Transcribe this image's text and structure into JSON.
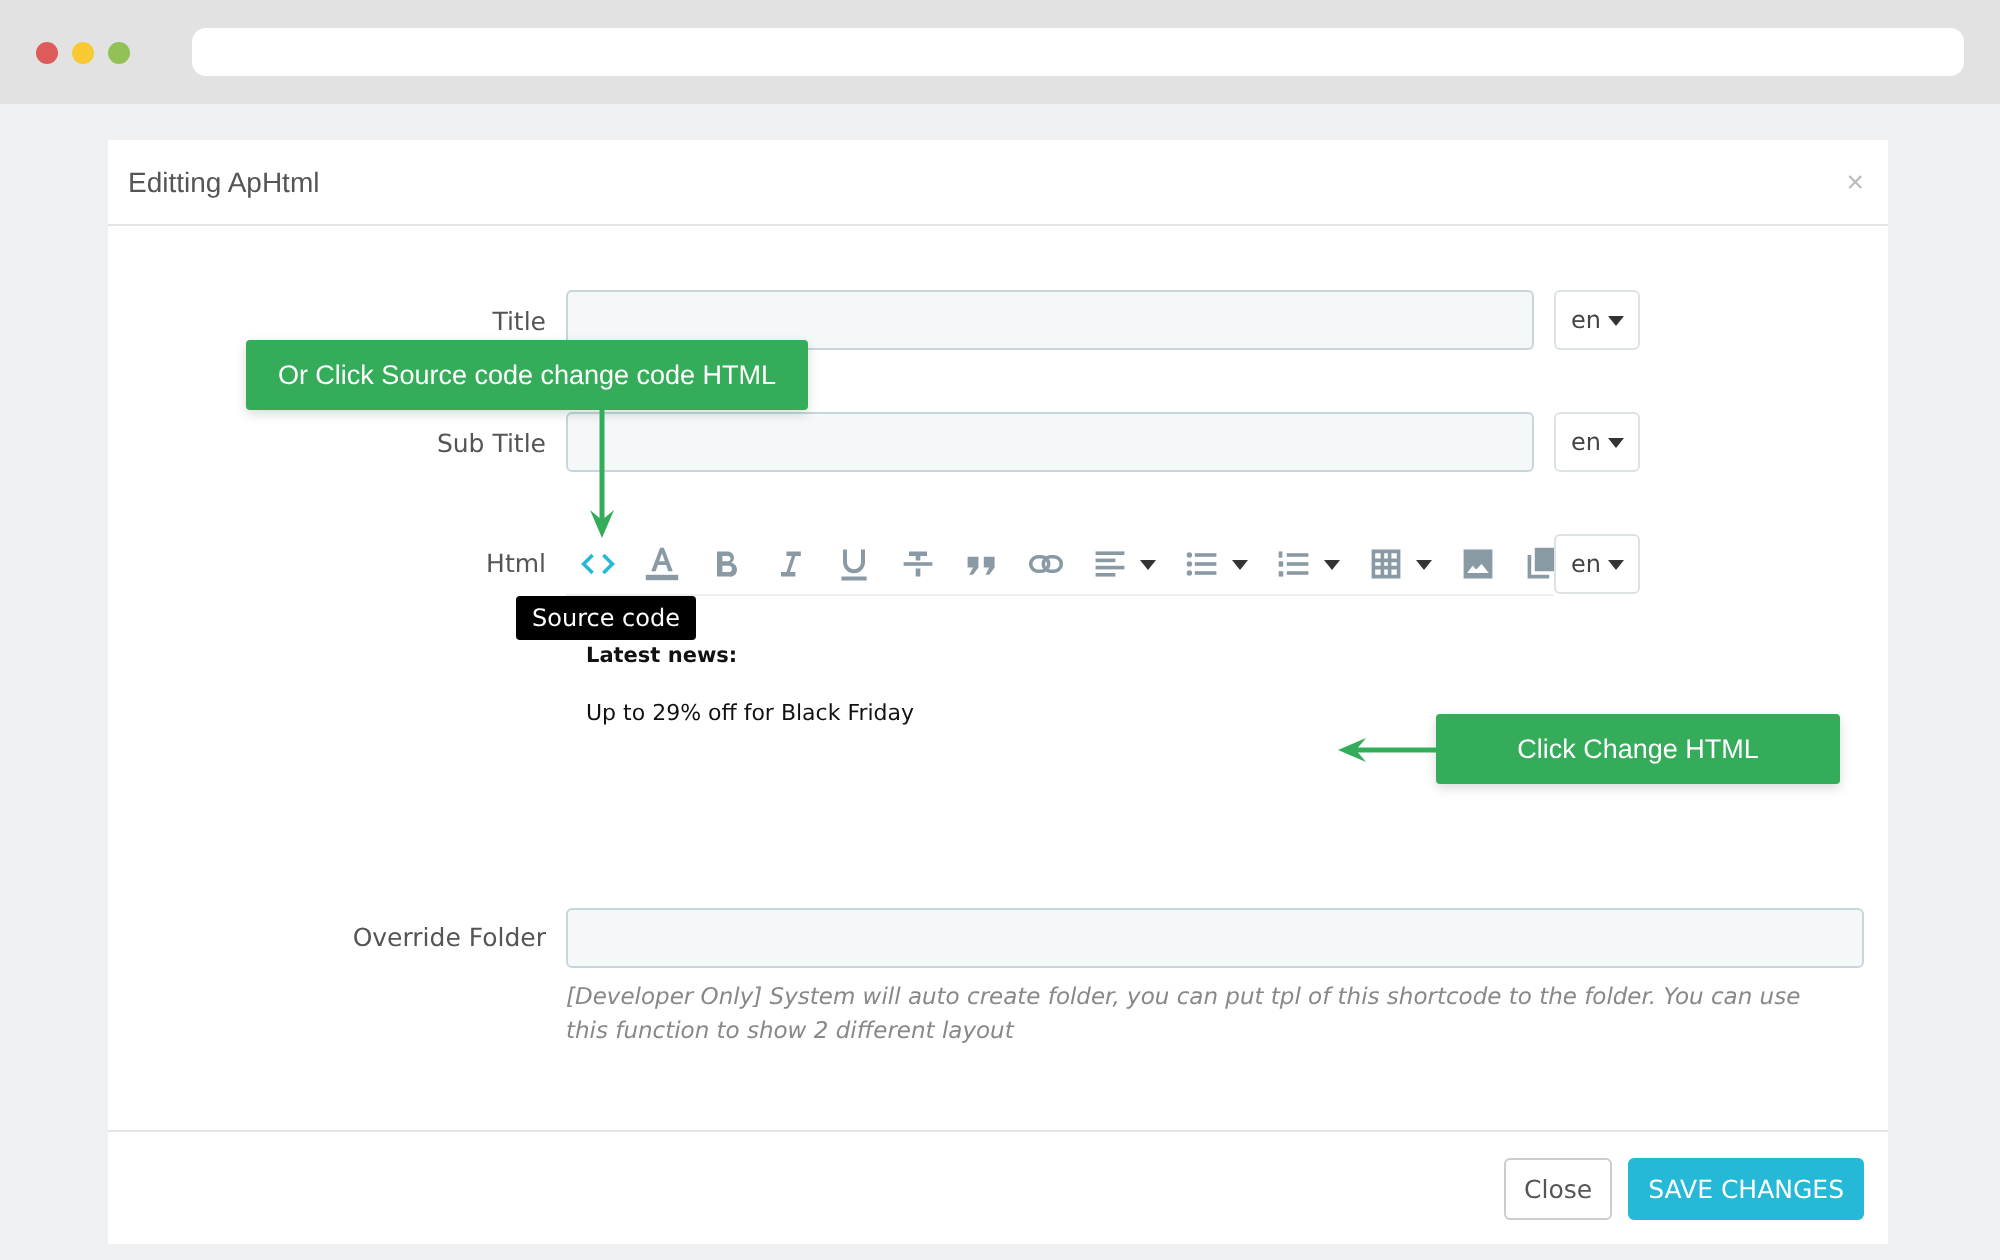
{
  "modal": {
    "title": "Editting ApHtml",
    "close_glyph": "×"
  },
  "fields": [
    {
      "kind": "text",
      "label": "Title",
      "lang": "en"
    },
    {
      "kind": "text",
      "label": "Sub Title",
      "lang": "en"
    },
    {
      "kind": "editor",
      "label": "Html",
      "lang": "en"
    }
  ],
  "toolbar": [
    {
      "kind": "code",
      "selected": true,
      "dropdown": false
    },
    {
      "kind": "font-color",
      "selected": false,
      "dropdown": false
    },
    {
      "kind": "bold",
      "selected": false,
      "dropdown": false
    },
    {
      "kind": "italic",
      "selected": false,
      "dropdown": false
    },
    {
      "kind": "underline",
      "selected": false,
      "dropdown": false
    },
    {
      "kind": "strike",
      "selected": false,
      "dropdown": false
    },
    {
      "kind": "quote",
      "selected": false,
      "dropdown": false
    },
    {
      "kind": "link",
      "selected": false,
      "dropdown": false
    },
    {
      "kind": "align",
      "selected": false,
      "dropdown": true
    },
    {
      "kind": "bullets",
      "selected": false,
      "dropdown": true
    },
    {
      "kind": "numbers",
      "selected": false,
      "dropdown": true
    },
    {
      "kind": "table",
      "selected": false,
      "dropdown": true
    },
    {
      "kind": "image",
      "selected": false,
      "dropdown": false
    },
    {
      "kind": "copy",
      "selected": false,
      "dropdown": false
    }
  ],
  "editor_content": {
    "heading": "Latest news:",
    "text": "Up to 29% off for Black Friday"
  },
  "tooltip": "Source code",
  "override_folder": {
    "label": "Override Folder",
    "help": "[Developer Only] System will auto create folder, you can put tpl of this shortcode to the folder. You can use this function to show 2 different layout"
  },
  "callouts": [
    {
      "kind": "down",
      "text": "Or Click Source code change code HTML"
    },
    {
      "kind": "left",
      "text": "Click Change HTML"
    }
  ],
  "buttons": [
    {
      "kind": "default",
      "label": "Close"
    },
    {
      "kind": "primary",
      "label": "SAVE CHANGES"
    }
  ]
}
